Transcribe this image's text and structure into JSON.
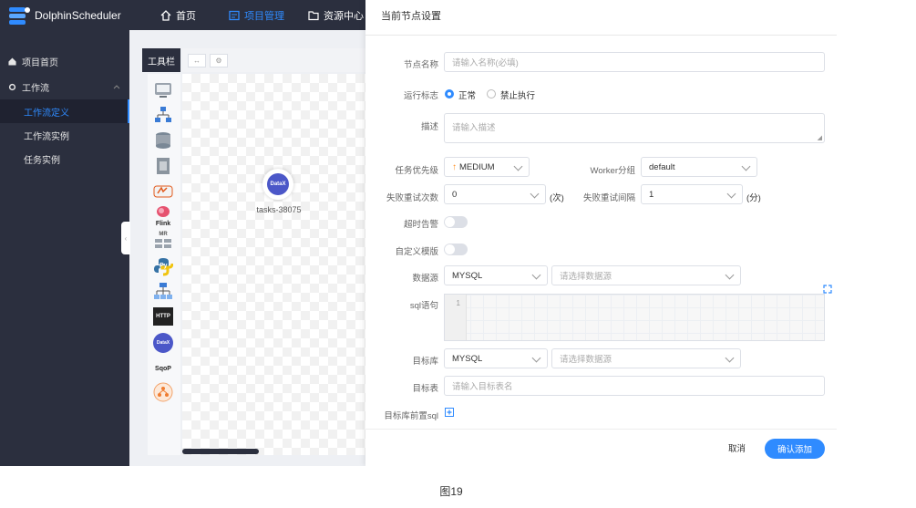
{
  "header": {
    "app_name": "DolphinScheduler",
    "nav": [
      {
        "label": "首页",
        "icon": "home-icon"
      },
      {
        "label": "项目管理",
        "icon": "project-icon"
      },
      {
        "label": "资源中心",
        "icon": "folder-icon"
      }
    ]
  },
  "sidebar": {
    "items": [
      {
        "label": "项目首页",
        "icon": "home-icon"
      },
      {
        "label": "工作流",
        "icon": "gear-icon"
      },
      {
        "label": "工作流定义"
      },
      {
        "label": "工作流实例"
      },
      {
        "label": "任务实例"
      }
    ]
  },
  "canvas": {
    "toolbar_label": "工具栏",
    "node_icon_text": "DataX",
    "node_label": "tasks-38075",
    "tools": [
      "shell-icon",
      "sub-process-icon",
      "procedure-icon",
      "sql-icon",
      "spark-icon",
      "flink-icon",
      "mr-icon",
      "python-icon",
      "dependent-icon",
      "http-icon",
      "datax-icon",
      "sqoop-icon",
      "conditions-icon"
    ],
    "tool_texts": {
      "flink": "Flink",
      "mr": "MR",
      "python": "Py",
      "http": "HTTP",
      "datax": "DataX",
      "sqoop": "SqoP"
    }
  },
  "drawer": {
    "title": "当前节点设置",
    "node_name": {
      "label": "节点名称",
      "placeholder": "请输入名称(必填)"
    },
    "run_flag": {
      "label": "运行标志",
      "options": [
        "正常",
        "禁止执行"
      ],
      "selected": "正常"
    },
    "description": {
      "label": "描述",
      "placeholder": "请输入描述"
    },
    "priority": {
      "label": "任务优先级",
      "value": "MEDIUM",
      "color": "#ff8c1a"
    },
    "worker_group": {
      "label": "Worker分组",
      "value": "default"
    },
    "retry_times": {
      "label": "失败重试次数",
      "value": "0",
      "unit": "(次)"
    },
    "retry_interval": {
      "label": "失败重试间隔",
      "value": "1",
      "unit": "(分)"
    },
    "timeout_alarm": {
      "label": "超时告警"
    },
    "custom_template": {
      "label": "自定义模版"
    },
    "datasource": {
      "label": "数据源",
      "type": "MYSQL",
      "placeholder": "请选择数据源"
    },
    "sql": {
      "label": "sql语句",
      "line": "1"
    },
    "target_db": {
      "label": "目标库",
      "type": "MYSQL",
      "placeholder": "请选择数据源"
    },
    "target_table": {
      "label": "目标表",
      "placeholder": "请输入目标表名"
    },
    "pre_sql": {
      "label": "目标库前置sql"
    },
    "cancel_label": "取消",
    "confirm_label": "确认添加"
  },
  "caption": "图19",
  "colors": {
    "dark": "#2b2f3e",
    "accent": "#2f8bff"
  }
}
